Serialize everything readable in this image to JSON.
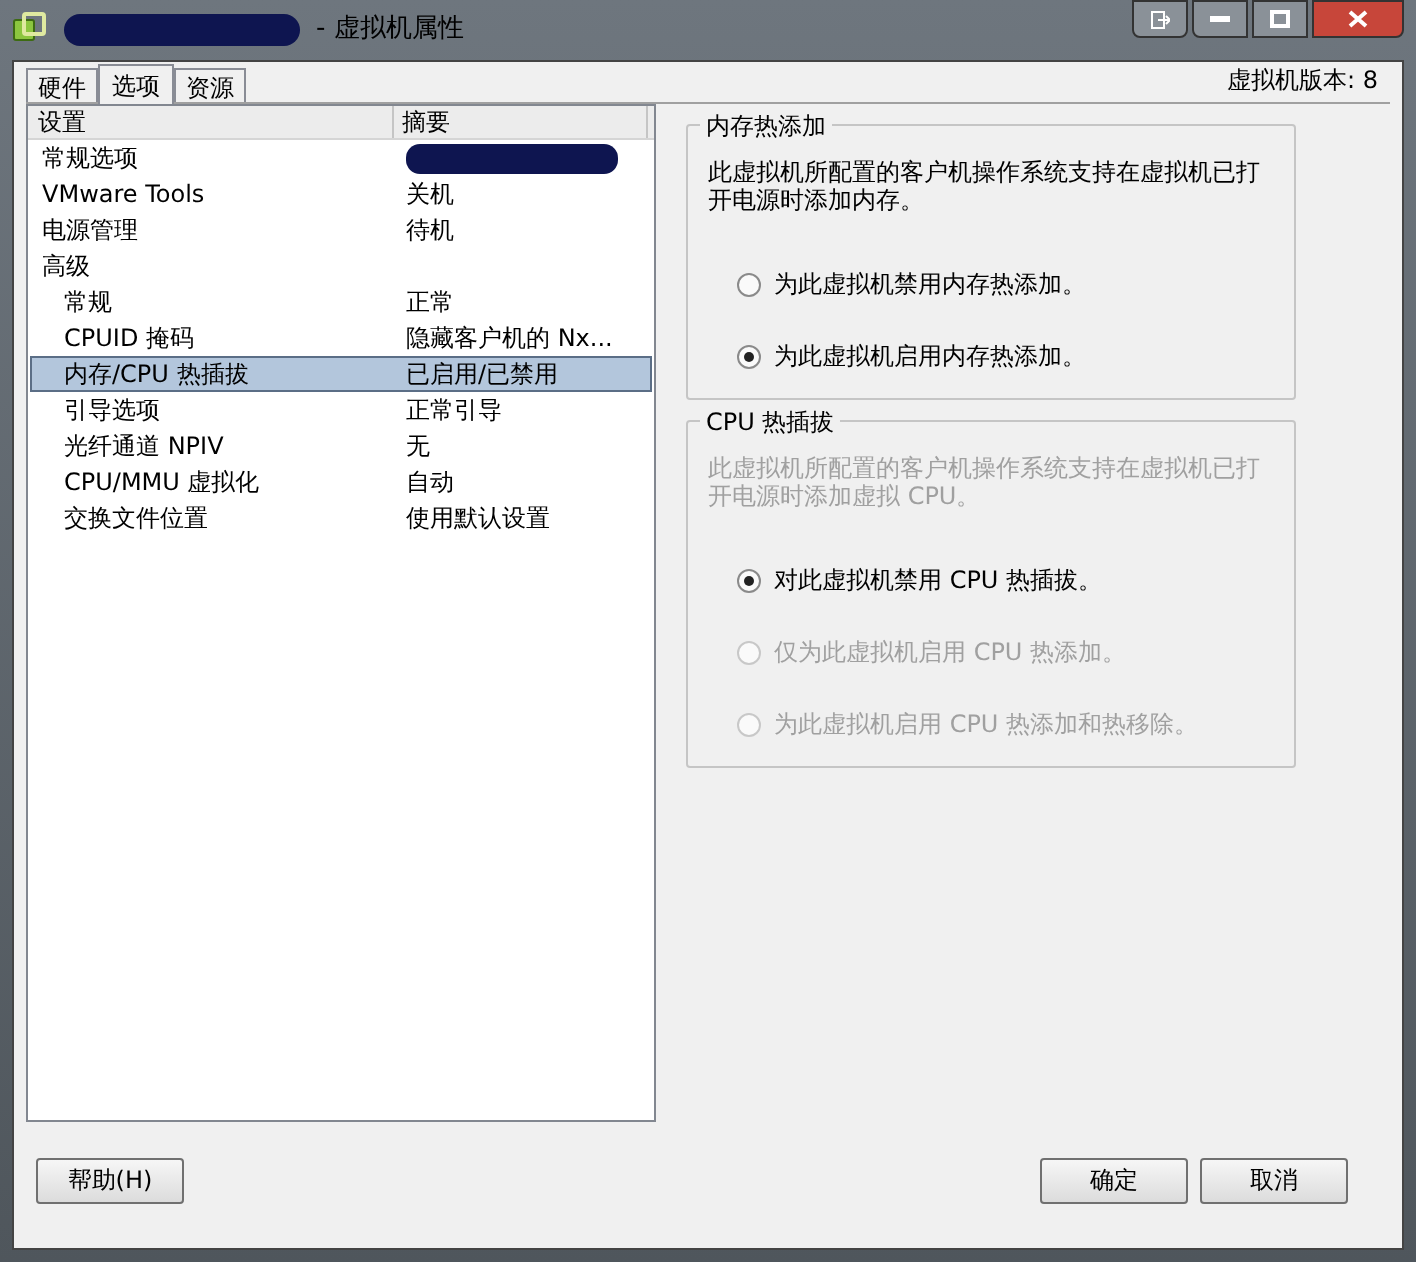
{
  "window": {
    "title": "- 虚拟机属性"
  },
  "tabs": [
    {
      "label": "硬件",
      "selected": false
    },
    {
      "label": "选项",
      "selected": true
    },
    {
      "label": "资源",
      "selected": false
    }
  ],
  "vm_version": "虚拟机版本: 8",
  "settings_list": {
    "columns": [
      "设置",
      "摘要"
    ],
    "rows": [
      {
        "setting": "常规选项",
        "summary_redacted": true,
        "selected": false
      },
      {
        "setting": "VMware Tools",
        "summary": "关机",
        "selected": false
      },
      {
        "setting": "电源管理",
        "summary": "待机",
        "selected": false
      },
      {
        "setting": "高级",
        "selected": false,
        "children": [
          {
            "setting": "常规",
            "summary": "正常",
            "selected": false
          },
          {
            "setting": "CPUID 掩码",
            "summary": "隐藏客户机的 Nx...",
            "selected": false
          },
          {
            "setting": "内存/CPU 热插拔",
            "summary": "已启用/已禁用",
            "selected": true
          },
          {
            "setting": "引导选项",
            "summary": "正常引导",
            "selected": false
          },
          {
            "setting": "光纤通道 NPIV",
            "summary": "无",
            "selected": false
          },
          {
            "setting": "CPU/MMU 虚拟化",
            "summary": "自动",
            "selected": false
          },
          {
            "setting": "交换文件位置",
            "summary": "使用默认设置",
            "selected": false
          }
        ]
      }
    ]
  },
  "groups": [
    {
      "title": "内存热添加",
      "description": "此虚拟机所配置的客户机操作系统支持在虚拟机已打开电源时添加内存。",
      "disabled": false,
      "options": [
        {
          "label": "为此虚拟机禁用内存热添加。",
          "selected": false,
          "disabled": false
        },
        {
          "label": "为此虚拟机启用内存热添加。",
          "selected": true,
          "disabled": false
        }
      ]
    },
    {
      "title": "CPU 热插拔",
      "description": "此虚拟机所配置的客户机操作系统支持在虚拟机已打开电源时添加虚拟 CPU。",
      "disabled": true,
      "options": [
        {
          "label": "对此虚拟机禁用 CPU 热插拔。",
          "selected": true,
          "disabled": false
        },
        {
          "label": "仅为此虚拟机启用 CPU 热添加。",
          "selected": false,
          "disabled": true
        },
        {
          "label": "为此虚拟机启用 CPU 热添加和热移除。",
          "selected": false,
          "disabled": true
        }
      ]
    }
  ],
  "buttons": {
    "help": "帮助(H)",
    "ok": "确定",
    "cancel": "取消"
  }
}
